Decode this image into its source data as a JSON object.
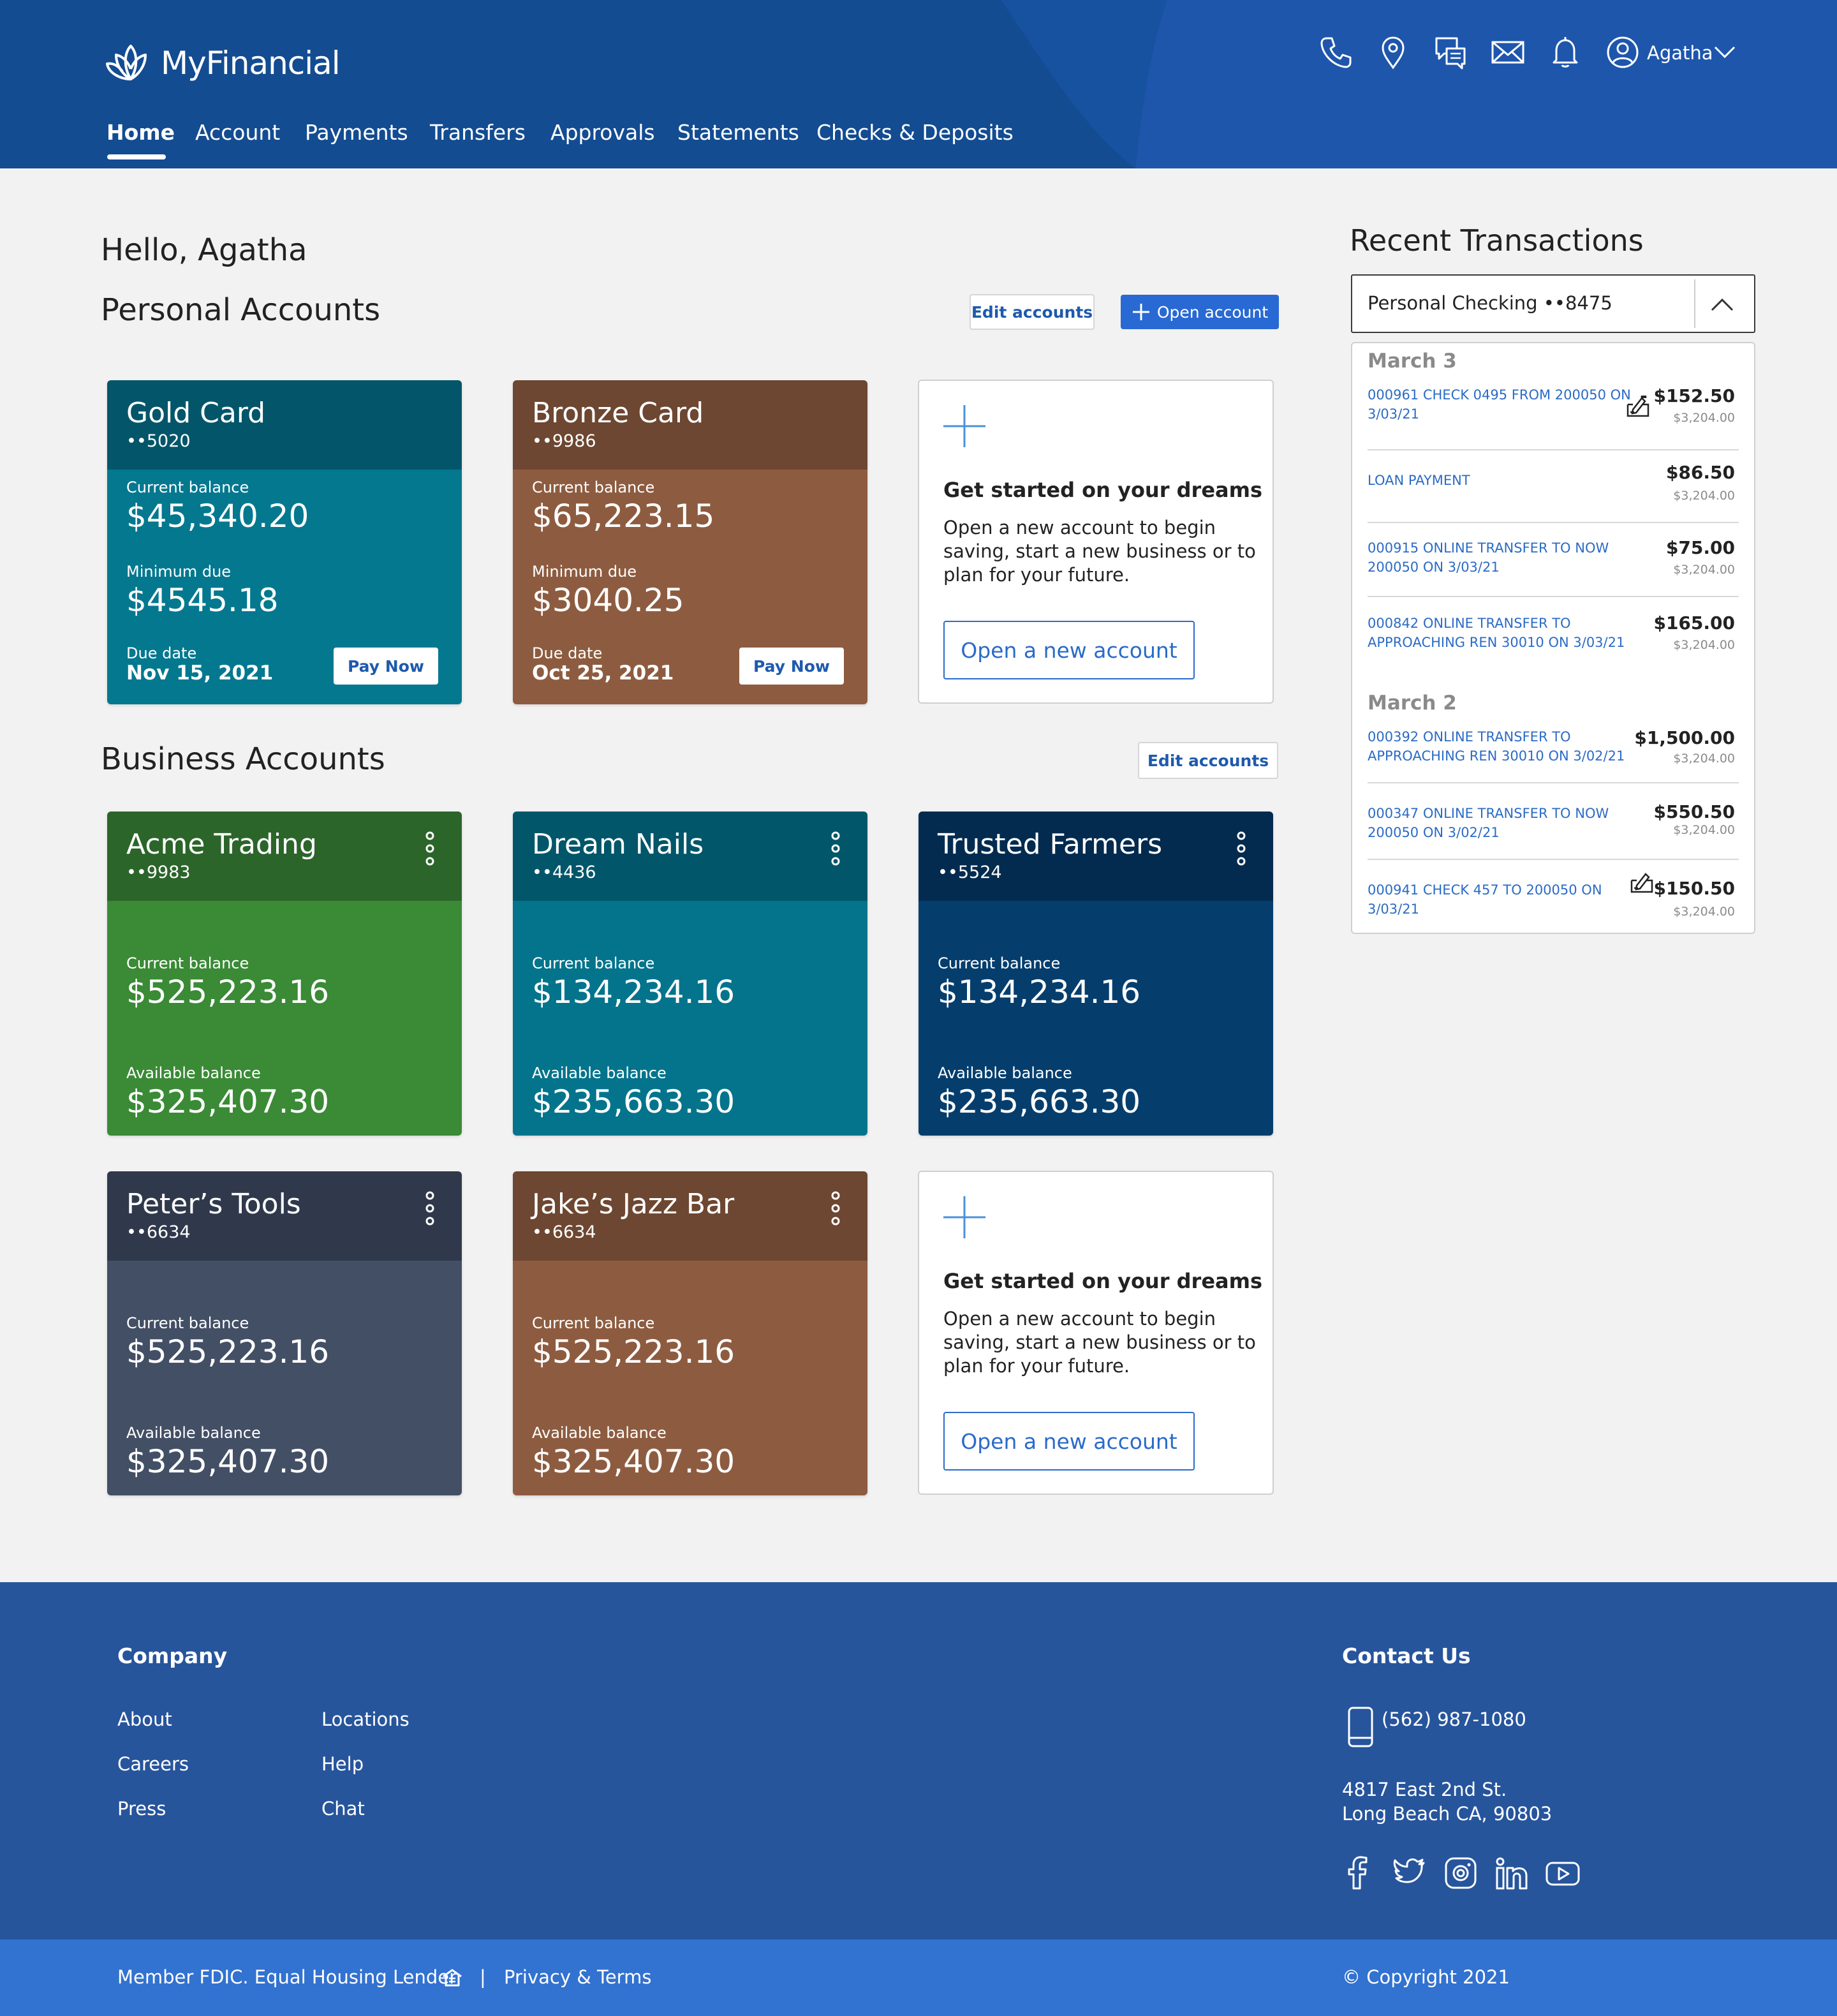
{
  "header": {
    "brand": "MyFinancial",
    "nav": [
      "Home",
      "Account",
      "Payments",
      "Transfers",
      "Approvals",
      "Statements",
      "Checks & Deposits"
    ],
    "active_nav": "Home",
    "icons": [
      "phone-icon",
      "location-pin-icon",
      "chat-icon",
      "mail-icon",
      "bell-icon",
      "user-icon",
      "chevron-down-icon"
    ],
    "user_name": "Agatha"
  },
  "greeting": "Hello, Agatha",
  "personal": {
    "title": "Personal Accounts",
    "edit_label": "Edit accounts",
    "open_label": "Open account",
    "cards": [
      {
        "name": "Gold Card",
        "number": "••5020",
        "current_label": "Current balance",
        "current": "$45,340.20",
        "min_label": "Minimum due",
        "min": "$4545.18",
        "due_label": "Due date",
        "due": "Nov 15, 2021",
        "pay_label": "Pay Now"
      },
      {
        "name": "Bronze Card",
        "number": "••9986",
        "current_label": "Current balance",
        "current": "$65,223.15",
        "min_label": "Minimum due",
        "min": "$3040.25",
        "due_label": "Due date",
        "due": "Oct 25, 2021",
        "pay_label": "Pay Now"
      }
    ],
    "promo": {
      "title": "Get started on your dreams",
      "text": "Open a new account to begin saving, start a new business or to plan for your future.",
      "button": "Open a new account"
    }
  },
  "business": {
    "title": "Business Accounts",
    "edit_label": "Edit accounts",
    "cards": [
      {
        "name": "Acme Trading",
        "number": "••9983",
        "current_label": "Current balance",
        "current": "$525,223.16",
        "avail_label": "Available balance",
        "avail": "$325,407.30"
      },
      {
        "name": "Dream Nails",
        "number": "••4436",
        "current_label": "Current balance",
        "current": "$134,234.16",
        "avail_label": "Available balance",
        "avail": "$235,663.30"
      },
      {
        "name": "Trusted Farmers",
        "number": "••5524",
        "current_label": "Current balance",
        "current": "$134,234.16",
        "avail_label": "Available balance",
        "avail": "$235,663.30"
      },
      {
        "name": "Peter’s Tools",
        "number": "••6634",
        "current_label": "Current balance",
        "current": "$525,223.16",
        "avail_label": "Available balance",
        "avail": "$325,407.30"
      },
      {
        "name": "Jake’s Jazz Bar",
        "number": "••6634",
        "current_label": "Current balance",
        "current": "$525,223.16",
        "avail_label": "Available balance",
        "avail": "$325,407.30"
      }
    ],
    "promo": {
      "title": "Get started on your dreams",
      "text": "Open a new account to begin saving, start a new business or to plan for your future.",
      "button": "Open a new account"
    }
  },
  "colors": {
    "gold_head": "#03566a",
    "gold_body": "#04788f",
    "bronze_head": "#6d4731",
    "bronze_body": "#8d5c40",
    "acme_head": "#2c652a",
    "acme_body": "#3a8a36",
    "dream_head": "#01566a",
    "dream_body": "#03748c",
    "trusted_head": "#032b4f",
    "trusted_body": "#053e6d",
    "peter_head": "#30394c",
    "peter_body": "#434f65",
    "jake_head": "#6d4731",
    "jake_body": "#8d5c40"
  },
  "transactions": {
    "title": "Recent Transactions",
    "account": "Personal Checking ••8475",
    "groups": [
      {
        "date": "March 3",
        "items": [
          {
            "desc": "000961 CHECK 0495 FROM 200050 ON 3/03/21",
            "amount": "- $152.50",
            "balance": "$3,204.00",
            "check": true
          },
          {
            "desc": "LOAN PAYMENT",
            "amount": "$86.50",
            "balance": "$3,204.00",
            "check": false
          },
          {
            "desc": "000915 ONLINE TRANSFER TO NOW 200050 ON 3/03/21",
            "amount": "$75.00",
            "balance": "$3,204.00",
            "check": false
          },
          {
            "desc": "000842 ONLINE TRANSFER TO APPROACHING REN 30010 ON 3/03/21",
            "amount": "$165.00",
            "balance": "$3,204.00",
            "check": false
          }
        ]
      },
      {
        "date": "March 2",
        "items": [
          {
            "desc": "000392 ONLINE TRANSFER TO APPROACHING REN 30010 ON 3/02/21",
            "amount": "$1,500.00",
            "balance": "$3,204.00",
            "check": false
          },
          {
            "desc": "000347 ONLINE TRANSFER TO NOW 200050 ON 3/02/21",
            "amount": "$550.50",
            "balance": "$3,204.00",
            "check": false
          },
          {
            "desc": "000941 CHECK 457 TO 200050 ON 3/03/21",
            "amount": "$150.50",
            "balance": "$3,204.00",
            "check": true
          }
        ]
      }
    ]
  },
  "footer": {
    "company_title": "Company",
    "links_col1": [
      "About",
      "Careers",
      "Press"
    ],
    "links_col2": [
      "Locations",
      "Help",
      "Chat"
    ],
    "contact_title": "Contact Us",
    "phone": "(562) 987-1080",
    "address1": "4817 East 2nd St.",
    "address2": "Long Beach CA, 90803",
    "social": [
      "facebook-icon",
      "twitter-icon",
      "instagram-icon",
      "linkedin-icon",
      "youtube-icon"
    ],
    "fdic": "Member FDIC. Equal Housing Lender",
    "separator": "|",
    "privacy": "Privacy & Terms",
    "copyright": "© Copyright 2021"
  }
}
